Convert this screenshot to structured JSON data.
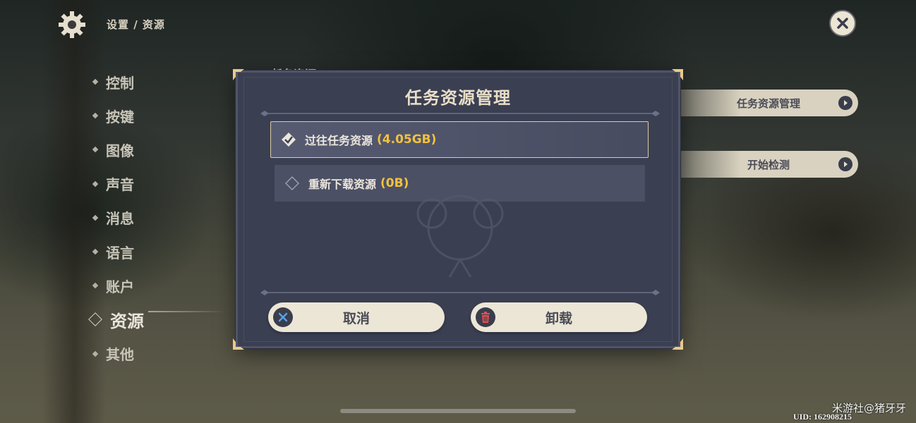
{
  "header": {
    "breadcrumb": "设置 / 资源"
  },
  "menu": {
    "items": [
      {
        "label": "控制"
      },
      {
        "label": "按键"
      },
      {
        "label": "图像"
      },
      {
        "label": "声音"
      },
      {
        "label": "消息"
      },
      {
        "label": "语言"
      },
      {
        "label": "账户"
      },
      {
        "label": "资源",
        "active": true
      },
      {
        "label": "其他"
      }
    ]
  },
  "background": {
    "section_label": "任务资源",
    "manage_button": "任务资源管理",
    "check_button": "开始检测"
  },
  "dialog": {
    "title": "任务资源管理",
    "options": [
      {
        "label": "过往任务资源",
        "size": "(4.05GB)",
        "checked": true
      },
      {
        "label": "重新下载资源",
        "size": "(0B)",
        "checked": false
      }
    ],
    "cancel_label": "取消",
    "uninstall_label": "卸载"
  },
  "footer": {
    "watermark": "米游社@猪牙牙",
    "uid": "UID: 162908215"
  },
  "colors": {
    "accent_gold": "#f1c23e",
    "dialog_bg": "#3b3f52",
    "button_bg": "#ece6d6"
  }
}
